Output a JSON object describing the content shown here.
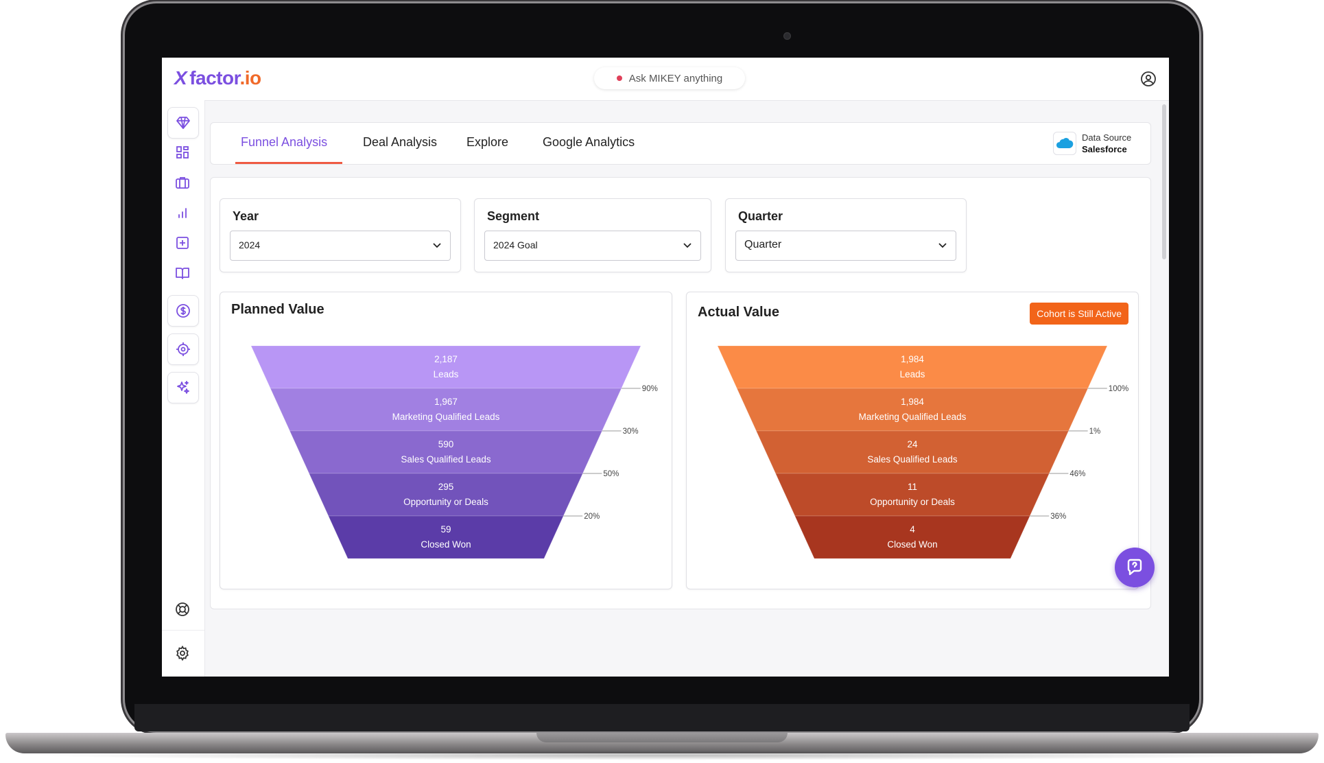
{
  "app": {
    "logo": {
      "mark": "X",
      "word": "factor",
      "suffix": ".io"
    },
    "ask_placeholder": "Ask MIKEY anything",
    "user_icon": "user-circle-icon"
  },
  "sidebar": {
    "items": [
      {
        "name": "diamond-icon",
        "active": true
      },
      {
        "name": "grid-icon"
      },
      {
        "name": "briefcase-icon"
      },
      {
        "name": "bar-chart-icon"
      },
      {
        "name": "plus-square-icon"
      },
      {
        "name": "book-icon"
      },
      {
        "name": "dollar-icon"
      },
      {
        "name": "target-icon"
      },
      {
        "name": "sparkle-icon"
      }
    ],
    "bottom": [
      {
        "name": "lifebuoy-icon"
      },
      {
        "name": "gear-icon"
      }
    ]
  },
  "tabs": [
    {
      "label": "Funnel Analysis",
      "active": true
    },
    {
      "label": "Deal Analysis"
    },
    {
      "label": "Explore"
    },
    {
      "label": "Google Analytics"
    }
  ],
  "data_source": {
    "label": "Data Source",
    "value": "Salesforce"
  },
  "filters": [
    {
      "label": "Year",
      "value": "2024"
    },
    {
      "label": "Segment",
      "value": "2024 Goal"
    },
    {
      "label": "Quarter",
      "value": "Quarter"
    }
  ],
  "planned": {
    "title": "Planned Value",
    "color_top": "#b896f5",
    "color_bottom": "#5b3ca8"
  },
  "actual": {
    "title": "Actual Value",
    "badge": "Cohort is Still Active",
    "badge_color": "#f26419",
    "color_top": "#fb8b47",
    "color_bottom": "#a8361f"
  },
  "chart_data": [
    {
      "type": "funnel",
      "title": "Planned Value",
      "stages": [
        "Leads",
        "Marketing Qualified Leads",
        "Sales Qualified Leads",
        "Opportunity or Deals",
        "Closed Won"
      ],
      "values": [
        2187,
        1967,
        590,
        295,
        59
      ],
      "value_labels": [
        "2,187",
        "1,967",
        "590",
        "295",
        "59"
      ],
      "conversion_rates": [
        "90%",
        "30%",
        "50%",
        "20%"
      ]
    },
    {
      "type": "funnel",
      "title": "Actual Value",
      "stages": [
        "Leads",
        "Marketing Qualified Leads",
        "Sales Qualified Leads",
        "Opportunity or Deals",
        "Closed Won"
      ],
      "values": [
        1984,
        1984,
        24,
        11,
        4
      ],
      "value_labels": [
        "1,984",
        "1,984",
        "24",
        "11",
        "4"
      ],
      "conversion_rates": [
        "100%",
        "1%",
        "46%",
        "36%"
      ]
    }
  ],
  "chat_button_icon": "chat-help-icon"
}
